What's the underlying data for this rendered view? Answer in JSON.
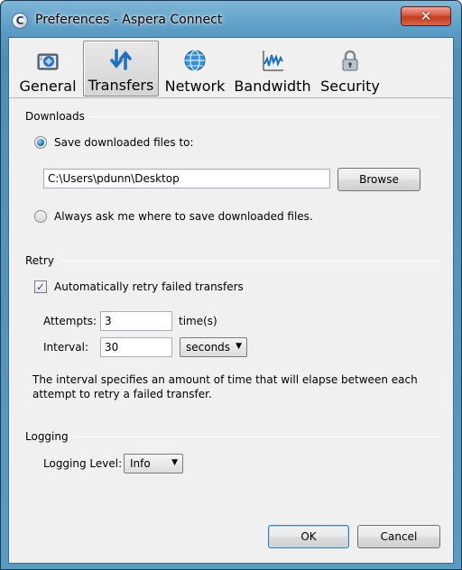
{
  "window": {
    "title": "Preferences - Aspera Connect"
  },
  "tabs": [
    {
      "label": "General",
      "icon": "general-settings-icon"
    },
    {
      "label": "Transfers",
      "icon": "transfer-arrows-icon",
      "active": true
    },
    {
      "label": "Network",
      "icon": "globe-icon"
    },
    {
      "label": "Bandwidth",
      "icon": "bandwidth-graph-icon"
    },
    {
      "label": "Security",
      "icon": "padlock-icon"
    }
  ],
  "downloads": {
    "section_title": "Downloads",
    "save_to_label": "Save downloaded files to:",
    "save_to_selected": true,
    "path_value": "C:\\Users\\pdunn\\Desktop",
    "browse_label": "Browse",
    "always_ask_label": "Always ask me where to save downloaded files.",
    "always_ask_selected": false
  },
  "retry": {
    "section_title": "Retry",
    "auto_retry_label": "Automatically retry failed transfers",
    "auto_retry_checked": true,
    "attempts_label": "Attempts:",
    "attempts_value": "3",
    "attempts_unit": "time(s)",
    "interval_label": "Interval:",
    "interval_value": "30",
    "interval_unit_selected": "seconds",
    "description": "The interval specifies an amount of time that will elapse between each attempt to retry a failed transfer."
  },
  "logging": {
    "section_title": "Logging",
    "level_label": "Logging Level:",
    "level_selected": "Info"
  },
  "footer": {
    "ok_label": "OK",
    "cancel_label": "Cancel"
  },
  "colors": {
    "title_bar": "#5d9ec6",
    "close_button": "#c33a1f",
    "dialog_background": "#f0f0f0"
  }
}
